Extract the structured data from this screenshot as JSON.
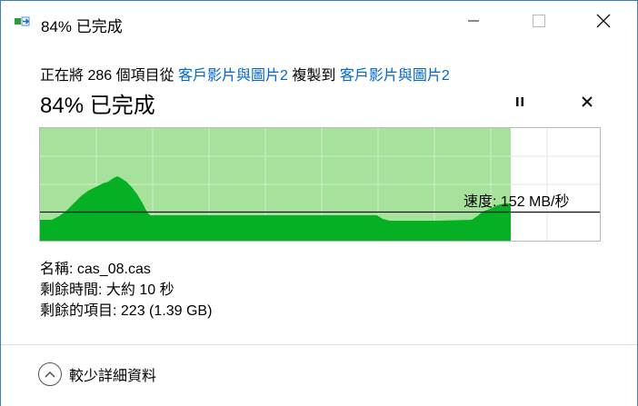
{
  "window": {
    "title": "84% 已完成"
  },
  "progress": {
    "description_prefix": "正在將 286 個項目從",
    "source": "客戶影片與圖片2",
    "middle": "複製到",
    "destination": "客戶影片與圖片2",
    "status_text": "84% 已完成",
    "percent": 84
  },
  "graph": {
    "speed_text": "速度: 152 MB/秒",
    "fill_color": "#06b025",
    "background_fill_color": "#a7e29d",
    "grid_color": "#c6ecc0"
  },
  "details": {
    "name_label": "名稱:",
    "name_value": "cas_08.cas",
    "time_label": "剩餘時間:",
    "time_value": "大約 10 秒",
    "items_label": "剩餘的項目:",
    "items_value": "223 (1.39 GB)"
  },
  "footer": {
    "less_details_label": "較少詳細資料"
  },
  "icons": {
    "app": "copy-arrow-icon",
    "minimize": "minimize-icon",
    "maximize": "maximize-icon",
    "close": "close-icon",
    "pause": "pause-icon",
    "cancel": "cancel-icon",
    "collapse": "chevron-up-icon"
  }
}
